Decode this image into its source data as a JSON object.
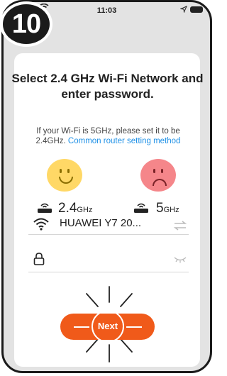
{
  "status_bar": {
    "time": "11:03"
  },
  "step": {
    "number": "10"
  },
  "screen": {
    "title": "Select 2.4 GHz Wi-Fi Network and enter password.",
    "subtitle": "If your Wi-Fi is 5GHz, please set it to be 2.4GHz.",
    "help_link": "Common router setting method"
  },
  "bands": {
    "good": {
      "value": "2.4",
      "unit": "GHz"
    },
    "bad": {
      "value": "5",
      "unit": "GHz"
    }
  },
  "wifi": {
    "ssid": "HUAWEI Y7 20..."
  },
  "password": {
    "value": ""
  },
  "next_button": {
    "label": "Next"
  },
  "colors": {
    "accent": "#f05a1a",
    "link": "#1e90e6",
    "happy_face": "#ffd866",
    "sad_face": "#f5868a"
  }
}
